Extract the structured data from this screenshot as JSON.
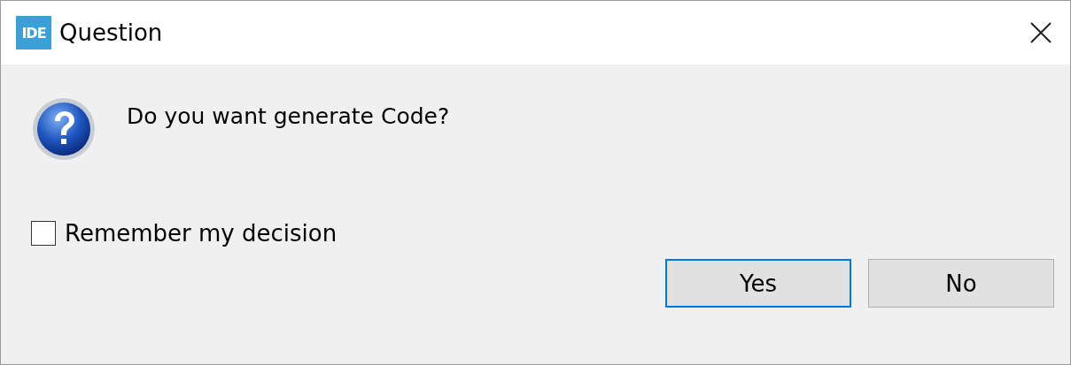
{
  "window": {
    "app_badge": "IDE",
    "title": "Question"
  },
  "message": "Do you want generate Code?",
  "remember": {
    "label": "Remember my decision",
    "checked": false
  },
  "buttons": [
    {
      "label": "Yes",
      "selected": true
    },
    {
      "label": "No",
      "selected": false
    }
  ]
}
